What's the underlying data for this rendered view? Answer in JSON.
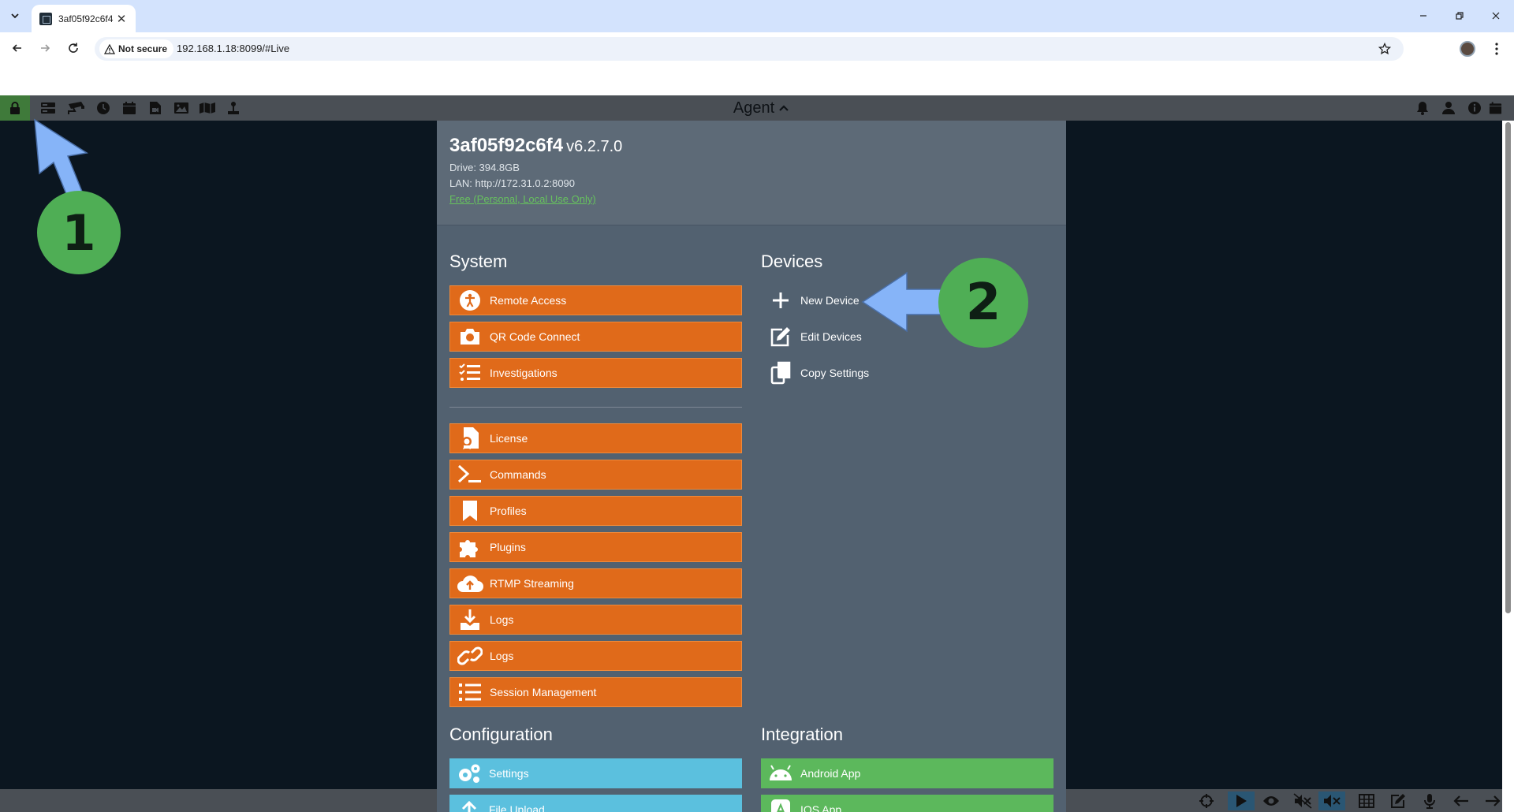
{
  "browser": {
    "tab_title": "3af05f92c6f4",
    "security_label": "Not secure",
    "url": "192.168.1.18:8099/#Live"
  },
  "appbar": {
    "agent_label": "Agent"
  },
  "panel": {
    "server_name": "3af05f92c6f4",
    "server_version": "v6.2.7.0",
    "drive": "Drive: 394.8GB",
    "lan": "LAN: http://172.31.0.2:8090",
    "license_link": "Free (Personal, Local Use Only)",
    "system": {
      "title": "System",
      "group1": [
        {
          "label": "Remote Access",
          "icon": "person-icon"
        },
        {
          "label": "QR Code Connect",
          "icon": "camera-icon"
        },
        {
          "label": "Investigations",
          "icon": "checklist-icon"
        }
      ],
      "group2": [
        {
          "label": "License",
          "icon": "certificate-icon"
        },
        {
          "label": "Commands",
          "icon": "terminal-icon"
        },
        {
          "label": "Profiles",
          "icon": "bookmark-icon"
        },
        {
          "label": "Plugins",
          "icon": "puzzle-icon"
        },
        {
          "label": "RTMP Streaming",
          "icon": "cloud-upload-icon"
        },
        {
          "label": "Logs",
          "icon": "download-icon"
        },
        {
          "label": "Logs",
          "icon": "link-icon"
        },
        {
          "label": "Session Management",
          "icon": "list-icon"
        }
      ]
    },
    "devices": {
      "title": "Devices",
      "items": [
        {
          "label": "New Device",
          "icon": "plus-icon"
        },
        {
          "label": "Edit Devices",
          "icon": "edit-icon"
        },
        {
          "label": "Copy Settings",
          "icon": "copy-icon"
        }
      ]
    },
    "configuration": {
      "title": "Configuration",
      "items": [
        {
          "label": "Settings",
          "icon": "gears-icon"
        },
        {
          "label": "File Upload",
          "icon": "upload-icon"
        }
      ]
    },
    "integration": {
      "title": "Integration",
      "items": [
        {
          "label": "Android App",
          "icon": "android-icon"
        },
        {
          "label": "IOS App",
          "icon": "apple-icon"
        }
      ]
    }
  },
  "annotations": {
    "step1": "1",
    "step2": "2",
    "arrow_color": "#86b4f8",
    "circle_color": "#4fae55"
  },
  "colors": {
    "orange": "#e06a1a",
    "blue": "#5bc0de",
    "green": "#5cb85c",
    "panel": "#526170"
  }
}
